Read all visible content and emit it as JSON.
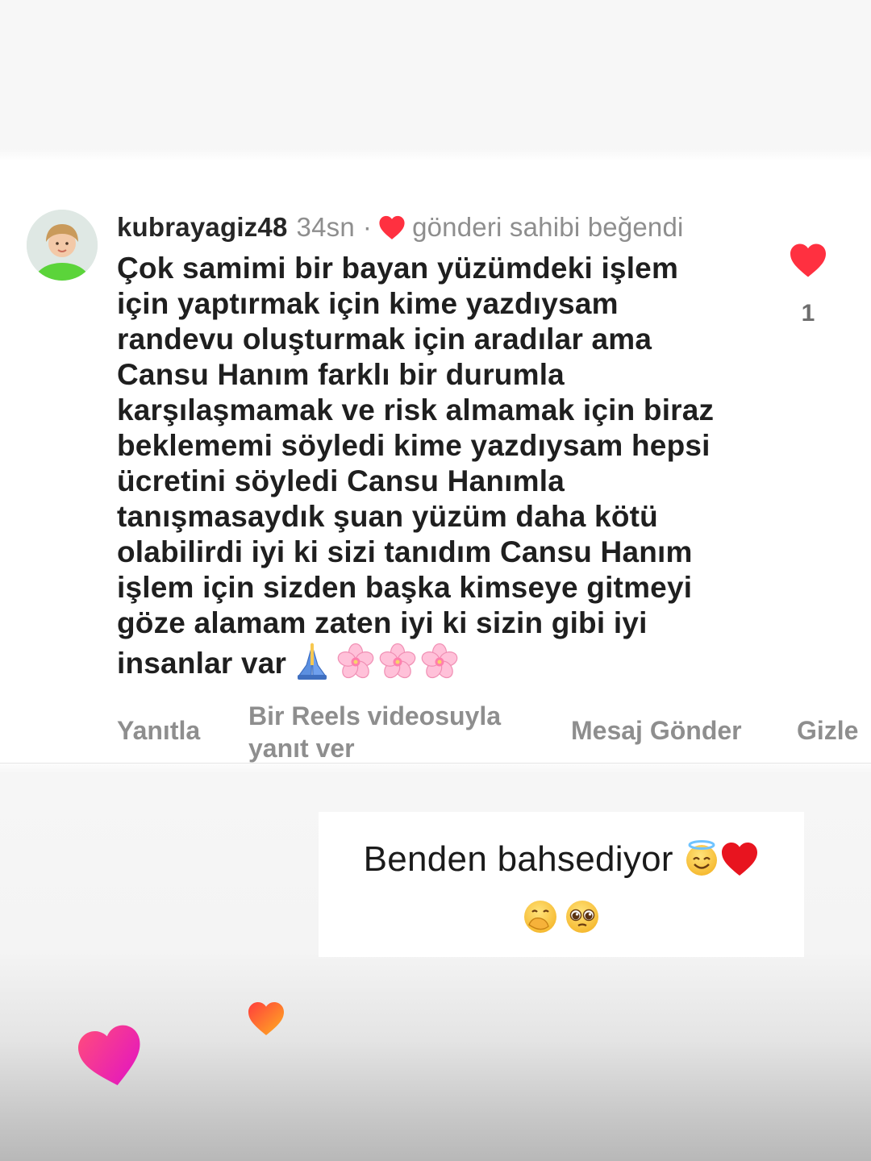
{
  "comment": {
    "username": "kubrayagiz48",
    "time": "34sn",
    "separator": "·",
    "creator_liked_text": "gönderi sahibi beğendi",
    "text_lines": [
      "Çok samimi bir bayan yüzümdeki işlem",
      "için yaptırmak için kime yazdıysam",
      "randevu oluşturmak için aradılar ama",
      "Cansu Hanım farklı bir durumla",
      "karşılaşmamak ve risk almamak için biraz",
      "beklememi söyledi kime yazdıysam hepsi",
      "ücretini söyledi Cansu Hanımla",
      "tanışmasaydık şuan yüzüm daha kötü",
      "olabilirdi iyi ki sizi tanıdım Cansu Hanım",
      "işlem için sizden başka kimseye gitmeyi",
      "göze alamam zaten iyi ki sizin gibi iyi",
      "insanlar var"
    ],
    "trailing_emoji": [
      "folded-hands",
      "cherry-blossom",
      "cherry-blossom",
      "cherry-blossom"
    ],
    "like_count": "1",
    "like_icon": "heart-icon",
    "like_color": "#ff3040"
  },
  "actions": {
    "reply": "Yanıtla",
    "reels_reply": "Bir Reels videosuyla yanıt ver",
    "send_message": "Mesaj Gönder",
    "hide": "Gizle"
  },
  "story_caption": {
    "text": "Benden bahsediyor",
    "emoji_line1": [
      "smiling-face-with-halo",
      "red-heart"
    ],
    "emoji_line2": [
      "face-with-hand-over-mouth",
      "pleading-face"
    ]
  },
  "decorations": {
    "floating_hearts": [
      "heart-sticker-pink",
      "heart-sticker-orange"
    ]
  },
  "colors": {
    "text_primary": "#262626",
    "text_secondary": "#8e8e8e",
    "heart_red": "#ff3040"
  }
}
